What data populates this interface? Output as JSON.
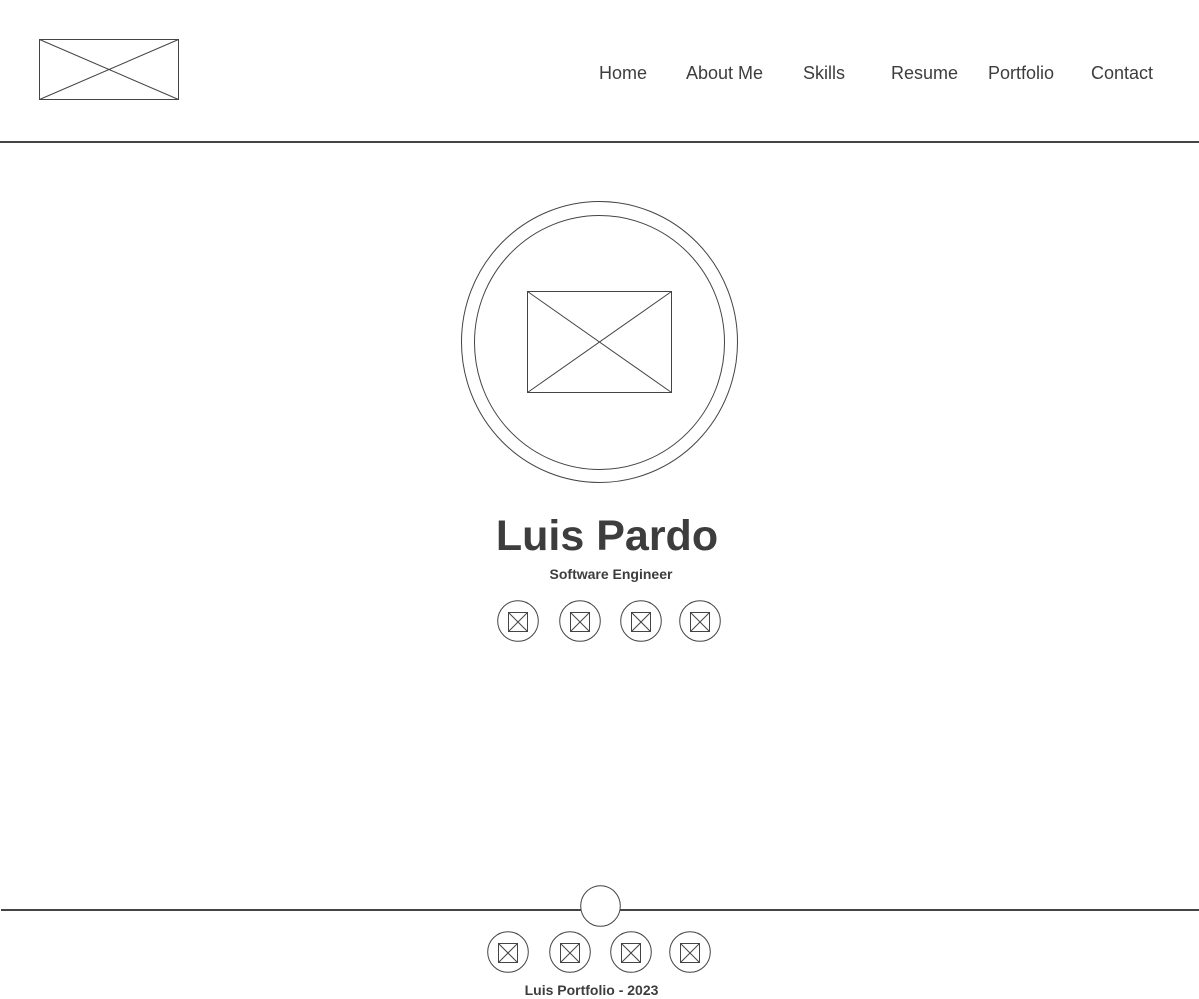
{
  "header": {
    "logo_icon": "image-placeholder-icon",
    "nav": [
      {
        "label": "Home"
      },
      {
        "label": "About Me"
      },
      {
        "label": "Skills"
      },
      {
        "label": "Resume"
      },
      {
        "label": "Portfolio"
      },
      {
        "label": "Contact"
      }
    ]
  },
  "hero": {
    "avatar_icon": "image-placeholder-icon",
    "name": "Luis Pardo",
    "subtitle": "Software Engineer",
    "social_icons": [
      "image-placeholder-icon",
      "image-placeholder-icon",
      "image-placeholder-icon",
      "image-placeholder-icon"
    ]
  },
  "footer": {
    "back_to_top_icon": "circle-button-icon",
    "social_icons": [
      "image-placeholder-icon",
      "image-placeholder-icon",
      "image-placeholder-icon",
      "image-placeholder-icon"
    ],
    "copyright": "Luis Portfolio - 2023"
  },
  "colors": {
    "text": "#3d3d3d",
    "line": "#444444",
    "background": "#ffffff"
  }
}
